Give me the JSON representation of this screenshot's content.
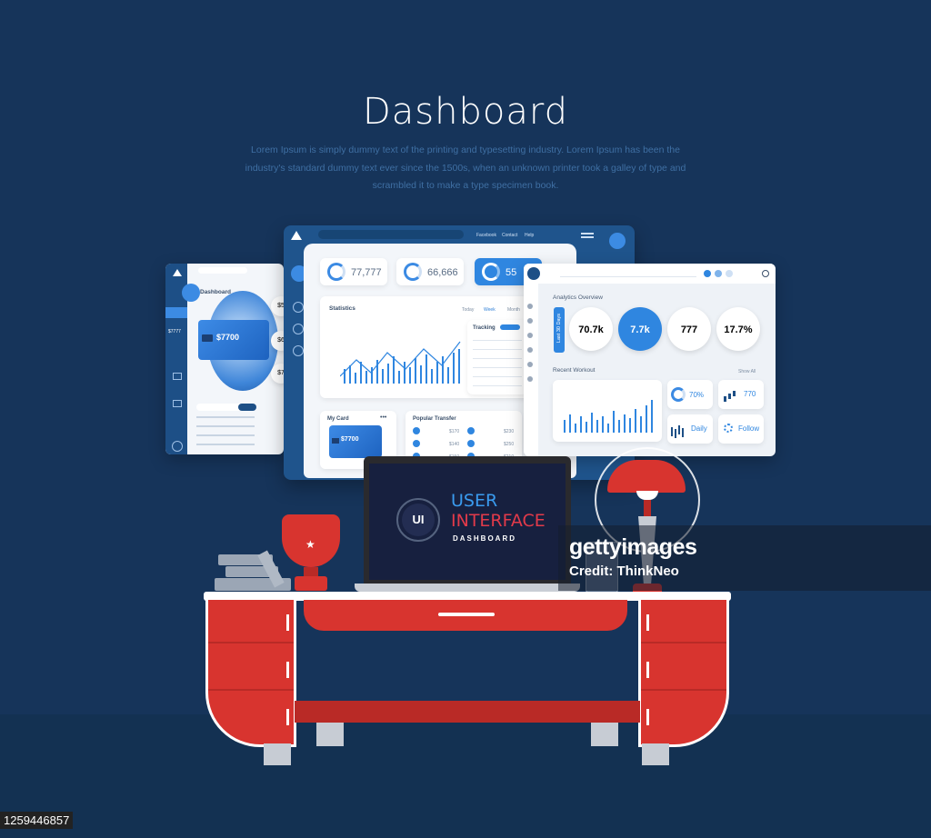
{
  "header": {
    "title": "Dashboard",
    "subtitle": "Lorem Ipsum is simply dummy text of the printing and typesetting industry. Lorem Ipsum has been the industry's standard dummy text ever since the 1500s, when an unknown printer took a galley of type and scrambled it to make a type specimen book."
  },
  "left_panel": {
    "heading": "Dashboard",
    "card_amount": "$7700",
    "side_amount": "$7777",
    "bubble_labels": [
      "$5",
      "$6",
      "$7"
    ]
  },
  "center_panel": {
    "nav": [
      "Facebook",
      "Contact",
      "Help"
    ],
    "stats": [
      "77,777",
      "66,666",
      "55"
    ],
    "statistics_title": "Statistics",
    "periods": [
      "Today",
      "Week",
      "Month"
    ],
    "tracking_title": "Tracking",
    "my_card_title": "My Card",
    "card_amount": "$7700",
    "transfer_title": "Popular Transfer",
    "transfer_amounts": [
      "$170",
      "$140",
      "$150",
      "$230",
      "$250",
      "$210"
    ]
  },
  "right_panel": {
    "analytics_title": "Analytics Overview",
    "tab_label": "Last 30 Days",
    "kpis": [
      "70.7k",
      "7.7k",
      "777",
      "17.7%"
    ],
    "recent_title": "Recent Workout",
    "show_all": "Show All",
    "small_cards": [
      "70%",
      "770",
      "Daily",
      "Follow"
    ]
  },
  "laptop": {
    "badge": "UI",
    "line1": "USER",
    "line2": "INTERFACE",
    "line3": "DASHBOARD"
  },
  "watermark": {
    "brand": "gettyimages",
    "credit": "Credit: ThinkNeo",
    "image_id": "1259446857"
  },
  "colors": {
    "background": "#16345a",
    "panel_blue": "#1f548c",
    "accent": "#2f86e0",
    "desk_red": "#d8342f"
  }
}
